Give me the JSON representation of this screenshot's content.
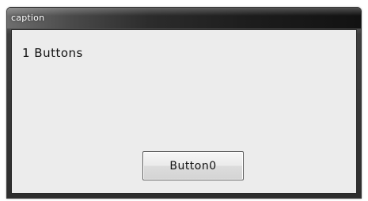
{
  "window": {
    "caption": "caption"
  },
  "dialog": {
    "message": "1 Buttons",
    "buttons": [
      {
        "label": "Button0"
      }
    ]
  }
}
